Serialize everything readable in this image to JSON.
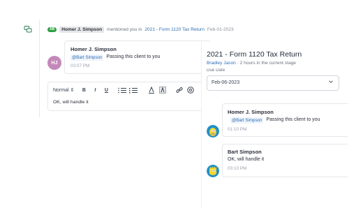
{
  "notification": {
    "icon": "chat-bubbles-icon",
    "badge": "AB",
    "actor": "Homer J. Simpson",
    "action": "mentioned you in",
    "link": "2021 - Form 1120 Tax Return",
    "date": "Feb-01-2023"
  },
  "comment": {
    "avatar_initials": "HJ",
    "avatar_color": "#c389b8",
    "author": "Homer J. Simpson",
    "mention": "@Bart Simpson",
    "text": "Passing this client to you",
    "time": "03:07 PM"
  },
  "editor": {
    "format_label": "Normal",
    "buttons": [
      "B",
      "I",
      "U"
    ],
    "icons": [
      "ordered-list-icon",
      "bullet-list-icon",
      "text-color-icon",
      "highlight-icon",
      "link-icon",
      "at-mention-icon"
    ],
    "text": "OK, will handle it"
  },
  "panel": {
    "title": "2021 - Form 1120 Tax Return",
    "assignee": "Bradley Jason",
    "stage_info": "· 2 hours in the current stage",
    "field_label": "Due Date",
    "due_date": "Feb-06-2023",
    "messages": [
      {
        "author": "Homer J. Simpson",
        "mention": "@Bart Simpson",
        "text": "Passing this client to you",
        "time": "01:10 PM",
        "avatar": "homer-avatar-icon"
      },
      {
        "author": "Bart Simpson",
        "text": "OK, will handle it",
        "time": "03:10 PM",
        "avatar": "bart-avatar-icon"
      }
    ]
  },
  "colors": {
    "accent": "#2f6fb3",
    "badge": "#2ea043",
    "muted": "#9ca3af"
  }
}
